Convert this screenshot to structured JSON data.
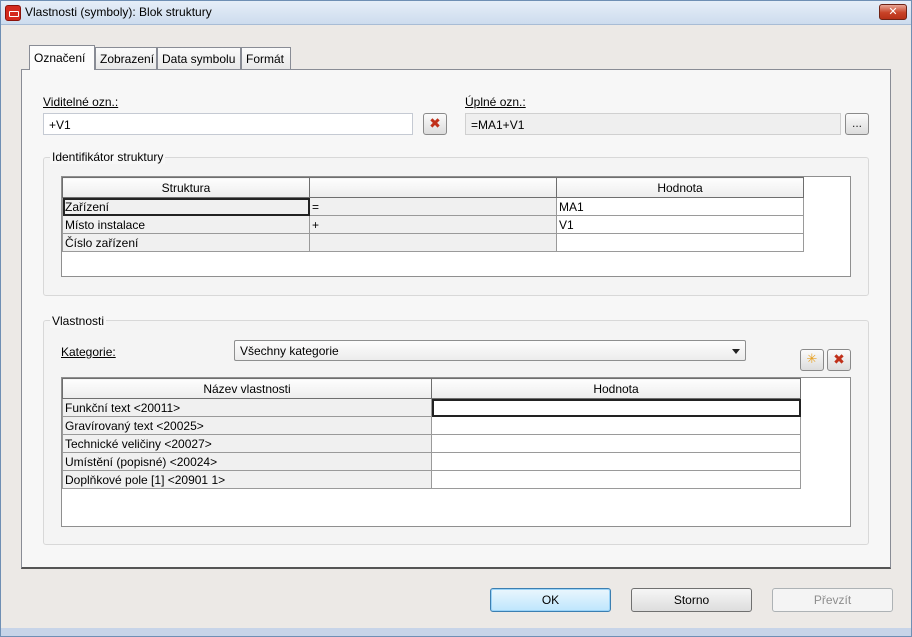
{
  "window": {
    "title": "Vlastnosti (symboly): Blok struktury",
    "close": "✕"
  },
  "tabs": [
    "Označení",
    "Zobrazení",
    "Data symbolu",
    "Formát"
  ],
  "visible_designation": {
    "label": "Viditelné ozn.:",
    "value": "+V1"
  },
  "full_designation": {
    "label": "Úplné ozn.:",
    "value": "=MA1+V1",
    "browse": "..."
  },
  "structure_group": {
    "title": "Identifikátor struktury",
    "headers": [
      "Struktura",
      "",
      "Hodnota"
    ],
    "rows": [
      [
        "Zařízení",
        "=",
        "MA1"
      ],
      [
        "Místo instalace",
        "+",
        "V1"
      ],
      [
        "Číslo zařízení",
        "",
        ""
      ]
    ]
  },
  "properties_group": {
    "title": "Vlastnosti",
    "category_label": "Kategorie:",
    "category_value": "Všechny kategorie",
    "headers": [
      "Název vlastnosti",
      "Hodnota"
    ],
    "rows": [
      [
        "Funkční text <20011>",
        ""
      ],
      [
        "Gravírovaný text <20025>",
        ""
      ],
      [
        "Technické veličiny <20027>",
        ""
      ],
      [
        "Umístění (popisné) <20024>",
        ""
      ],
      [
        "Doplňkové pole [1] <20901 1>",
        ""
      ]
    ]
  },
  "buttons": {
    "ok": "OK",
    "cancel": "Storno",
    "apply": "Převzít"
  },
  "colors": {
    "accent": "#3c7fb1",
    "delete": "#c0301a",
    "titlebar": "#cddcee"
  },
  "icons": {
    "delete": "x-icon",
    "new": "star-icon",
    "dropdown": "chevron-down-icon"
  }
}
